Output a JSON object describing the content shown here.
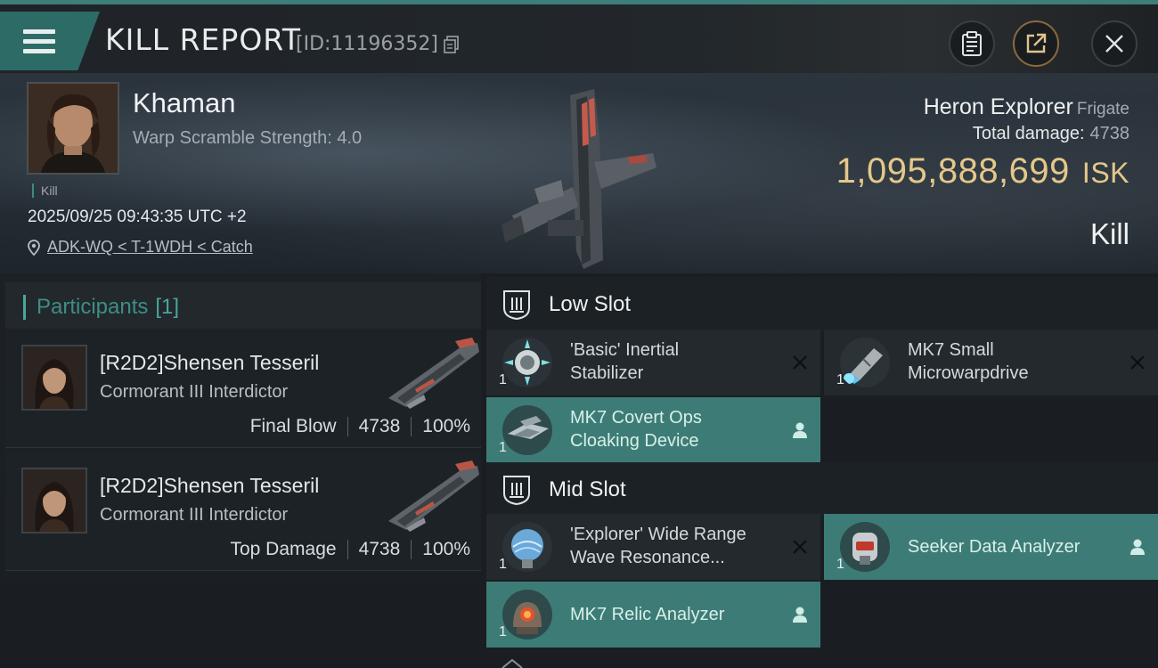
{
  "header": {
    "title": "KILL REPORT",
    "report_id": "[ID:11196352]"
  },
  "victim": {
    "name": "Khaman",
    "warp_scramble": "Warp Scramble Strength: 4.0",
    "tag": "Kill",
    "datetime": "2025/09/25 09:43:35 UTC +2",
    "location": "ADK-WQ < T-1WDH < Catch",
    "ship": "Heron Explorer",
    "ship_class": "Frigate",
    "total_damage_label": "Total damage:",
    "total_damage": "4738",
    "isk_value": "1,095,888,699",
    "isk_unit": "ISK",
    "result": "Kill"
  },
  "participants": {
    "label": "Participants",
    "count": "[1]",
    "rows": [
      {
        "name": "[R2D2]Shensen Tesseril",
        "ship": "Cormorant III Interdictor",
        "role": "Final Blow",
        "damage": "4738",
        "percent": "100%"
      },
      {
        "name": "[R2D2]Shensen Tesseril",
        "ship": "Cormorant III Interdictor",
        "role": "Top Damage",
        "damage": "4738",
        "percent": "100%"
      }
    ]
  },
  "fitting": {
    "low_slot_label": "Low Slot",
    "mid_slot_label": "Mid Slot",
    "low": [
      {
        "line1": "'Basic' Inertial",
        "line2": "Stabilizer",
        "qty": "1",
        "state": "destroyed"
      },
      {
        "line1": "MK7 Small",
        "line2": "Microwarpdrive",
        "qty": "1",
        "state": "destroyed"
      },
      {
        "line1": "MK7 Covert Ops",
        "line2": "Cloaking Device",
        "qty": "1",
        "state": "dropped"
      }
    ],
    "mid": [
      {
        "line1": "'Explorer' Wide Range",
        "line2": "Wave Resonance...",
        "qty": "1",
        "state": "destroyed"
      },
      {
        "line1": "Seeker Data Analyzer",
        "line2": "",
        "qty": "1",
        "state": "dropped"
      },
      {
        "line1": "MK7 Relic Analyzer",
        "line2": "",
        "qty": "1",
        "state": "dropped"
      }
    ]
  },
  "colors": {
    "accent": "#3d7f78",
    "isk": "#e4c88a",
    "dropped": "#3d7c76"
  }
}
